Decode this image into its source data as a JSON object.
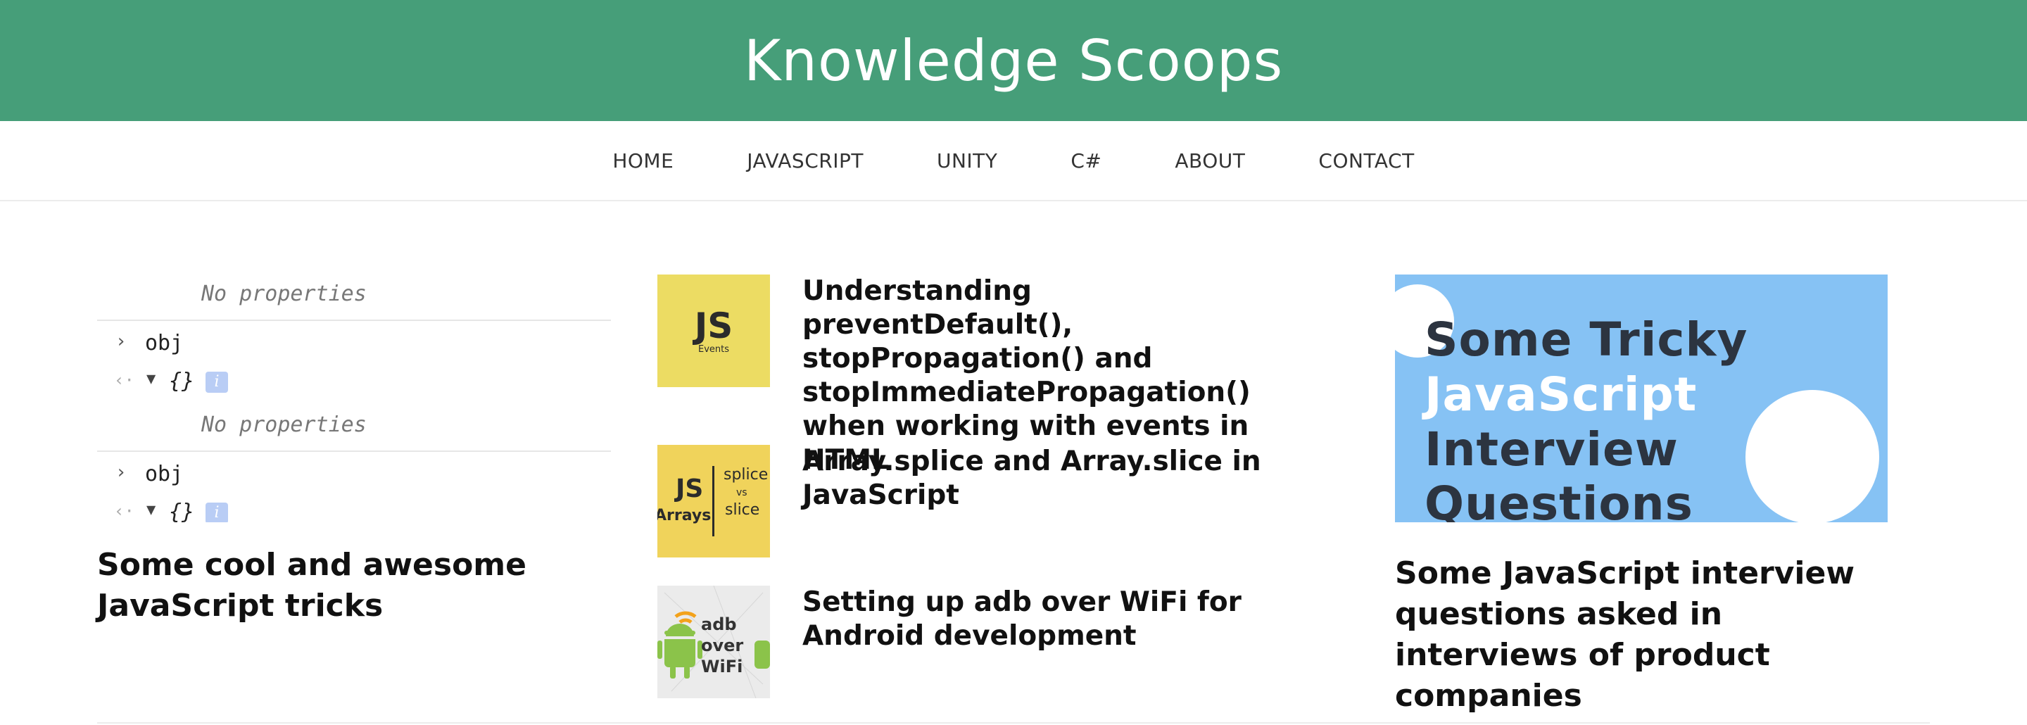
{
  "header": {
    "site_title": "Knowledge Scoops",
    "bg_color": "#469e79"
  },
  "nav": {
    "items": [
      "HOME",
      "JAVASCRIPT",
      "UNITY",
      "C#",
      "ABOUT",
      "CONTACT"
    ]
  },
  "left": {
    "console": {
      "no_properties": "No properties",
      "obj": "obj",
      "braces": "{}",
      "info": "i"
    },
    "title": "Some cool and awesome JavaScript tricks"
  },
  "middle": {
    "posts": [
      {
        "title": "Understanding preventDefault(), stopPropagation() and stopImmediatePropagation() when working with events in HTML",
        "thumb": {
          "main": "JS",
          "sub": "Events"
        }
      },
      {
        "title": "Array.splice and Array.slice in JavaScript",
        "thumb": {
          "main": "JS",
          "sub": "Arrays",
          "splice": "splice",
          "vs": "vs",
          "slice": "slice"
        }
      },
      {
        "title": "Setting up adb over WiFi for Android development",
        "thumb": {
          "line1": "adb over",
          "line2": "WiFi",
          "icon": "android-wifi-icon"
        }
      }
    ]
  },
  "right": {
    "image": {
      "line1": "Some Tricky",
      "line2": "JavaScript",
      "line3": "Interview Questions",
      "bg_color": "#86c2f4"
    },
    "title": "Some JavaScript interview questions asked in interviews of product companies"
  }
}
